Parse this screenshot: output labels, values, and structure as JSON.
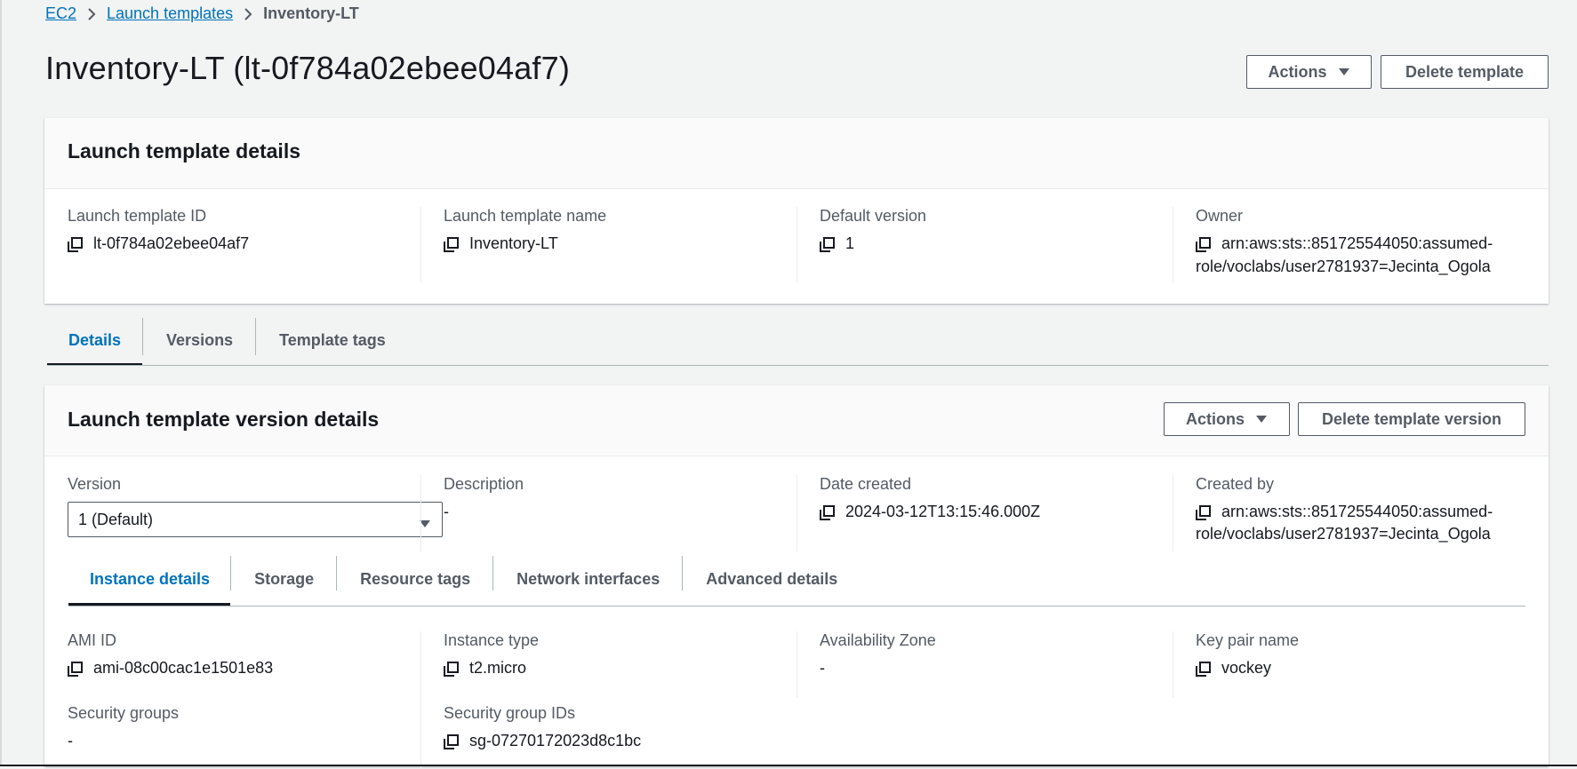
{
  "breadcrumb": {
    "items": [
      "EC2",
      "Launch templates"
    ],
    "current": "Inventory-LT"
  },
  "page": {
    "title": "Inventory-LT (lt-0f784a02ebee04af7)",
    "actions_label": "Actions",
    "delete_label": "Delete template"
  },
  "template_details": {
    "heading": "Launch template details",
    "fields": [
      {
        "label": "Launch template ID",
        "value": "lt-0f784a02ebee04af7"
      },
      {
        "label": "Launch template name",
        "value": "Inventory-LT"
      },
      {
        "label": "Default version",
        "value": "1"
      },
      {
        "label": "Owner",
        "value_line1": "arn:aws:sts::851725544050:assumed-",
        "value_line2": "role/voclabs/user2781937=Jecinta_Ogola"
      }
    ]
  },
  "main_tabs": [
    "Details",
    "Versions",
    "Template tags"
  ],
  "version_details": {
    "heading": "Launch template version details",
    "actions_label": "Actions",
    "delete_label": "Delete template version",
    "version_label": "Version",
    "version_selected": "1 (Default)",
    "description_label": "Description",
    "description_value": "-",
    "date_created_label": "Date created",
    "date_created_value": "2024-03-12T13:15:46.000Z",
    "created_by_label": "Created by",
    "created_by_line1": "arn:aws:sts::851725544050:assumed-",
    "created_by_line2": "role/voclabs/user2781937=Jecinta_Ogola"
  },
  "sub_tabs": [
    "Instance details",
    "Storage",
    "Resource tags",
    "Network interfaces",
    "Advanced details"
  ],
  "instance_details": {
    "ami_id_label": "AMI ID",
    "ami_id_value": "ami-08c00cac1e1501e83",
    "instance_type_label": "Instance type",
    "instance_type_value": "t2.micro",
    "availability_zone_label": "Availability Zone",
    "availability_zone_value": "-",
    "key_pair_label": "Key pair name",
    "key_pair_value": "vockey",
    "security_groups_label": "Security groups",
    "security_groups_value": "-",
    "security_group_ids_label": "Security group IDs",
    "security_group_ids_value": "sg-07270172023d8c1bc"
  },
  "icons": {
    "copy": "copy-icon",
    "chevron": "chevron-right-icon",
    "caret": "caret-down-icon"
  },
  "colors": {
    "link": "#0073bb",
    "text": "#16191f",
    "muted": "#545b64",
    "background": "#f2f3f3"
  }
}
